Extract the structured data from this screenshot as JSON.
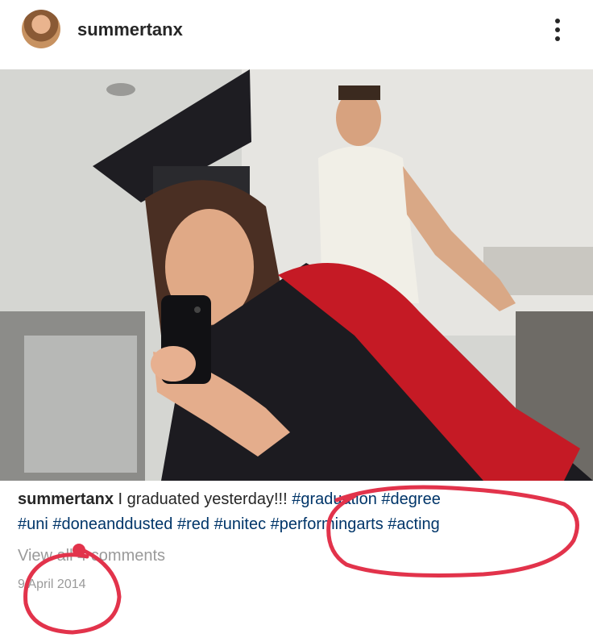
{
  "post": {
    "username": "summertanx",
    "more_icon": "more-vertical-icon",
    "caption": {
      "username": "summertanx",
      "text": "I graduated yesterday!!!",
      "line1_tags": [
        "#graduation",
        "#degree"
      ],
      "line2_tags": [
        "#uni",
        "#doneanddusted",
        "#red",
        "#unitec",
        "#performingarts",
        "#acting"
      ]
    },
    "comments_link": "View all 4 comments",
    "date": "9 April 2014"
  },
  "colors": {
    "hashtag": "#003569",
    "annotation": "#e2334b",
    "meta_text": "#9a9a9a"
  }
}
